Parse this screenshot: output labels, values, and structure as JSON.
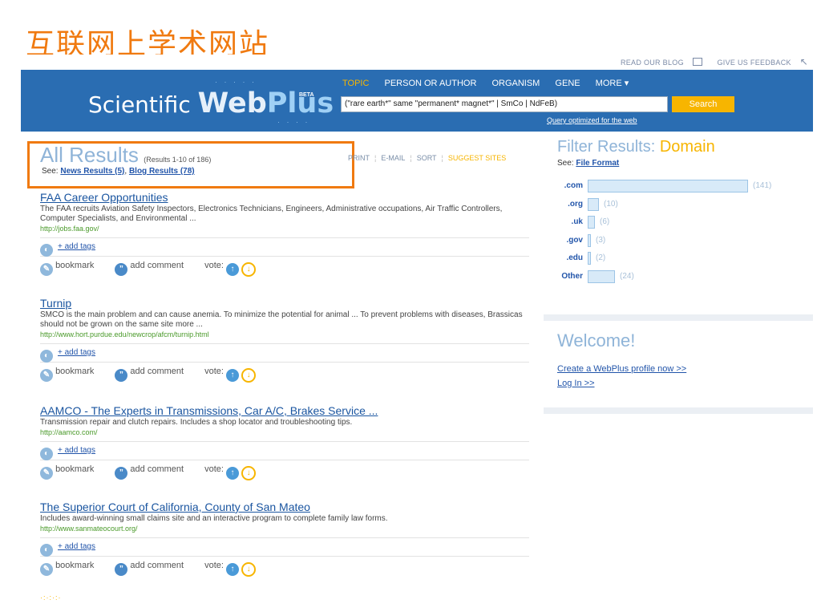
{
  "slide_title": "互联网上学术网站",
  "top_links": {
    "read_blog": "READ OUR BLOG",
    "feedback": "GIVE US FEEDBACK"
  },
  "logo": {
    "scientific": "Scientific",
    "web": "Web",
    "plus": "Plus",
    "beta": "BETA"
  },
  "tabs": [
    "TOPIC",
    "PERSON OR AUTHOR",
    "ORGANISM",
    "GENE",
    "MORE ▾"
  ],
  "search": {
    "query": "(\"rare earth*\" same \"permanent* magnet*\" | SmCo | NdFeB)",
    "button": "Search",
    "optimized": "Query optimized for the web"
  },
  "results_header": {
    "title": "All Results",
    "count": "(Results 1-10 of 186)",
    "see_label": "See:",
    "news_link": "News Results (5)",
    "blog_link": "Blog Results (78)"
  },
  "actions": {
    "print": "PRINT",
    "email": "E-MAIL",
    "sort": "SORT",
    "suggest": "SUGGEST SITES"
  },
  "result_labels": {
    "add_tags": "+ add tags",
    "bookmark": "bookmark",
    "comment": "add comment",
    "vote": "vote:"
  },
  "results": [
    {
      "title": "FAA Career Opportunities",
      "desc": "The FAA recruits Aviation Safety Inspectors, Electronics Technicians, Engineers, Administrative occupations, Air Traffic Controllers, Computer Specialists, and Environmental ...",
      "url": "http://jobs.faa.gov/"
    },
    {
      "title": "Turnip",
      "desc": "SMCO is the main problem and can cause anemia. To minimize the potential for animal ... To prevent problems with diseases, Brassicas should not be grown on the same site more ...",
      "url": "http://www.hort.purdue.edu/newcrop/afcm/turnip.html"
    },
    {
      "title": "AAMCO - The Experts in Transmissions, Car A/C, Brakes Service ...",
      "desc": "Transmission repair and clutch repairs. Includes a shop locator and troubleshooting tips.",
      "url": "http://aamco.com/"
    },
    {
      "title": "The Superior Court of California, County of San Mateo",
      "desc": "Includes award-winning small claims site and an interactive program to complete family law forms.",
      "url": "http://www.sanmateocourt.org/"
    }
  ],
  "filter": {
    "title": "Filter Results:",
    "domain": "Domain",
    "see_label": "See:",
    "file_format": "File Format",
    "rows": [
      {
        "label": ".com",
        "count": "(141)",
        "value": 141
      },
      {
        "label": ".org",
        "count": "(10)",
        "value": 10
      },
      {
        "label": ".uk",
        "count": "(6)",
        "value": 6
      },
      {
        "label": ".gov",
        "count": "(3)",
        "value": 3
      },
      {
        "label": ".edu",
        "count": "(2)",
        "value": 2
      },
      {
        "label": "Other",
        "count": "(24)",
        "value": 24
      }
    ]
  },
  "welcome": {
    "title": "Welcome!",
    "create": "Create a WebPlus profile now >>",
    "login": "Log In >>"
  }
}
